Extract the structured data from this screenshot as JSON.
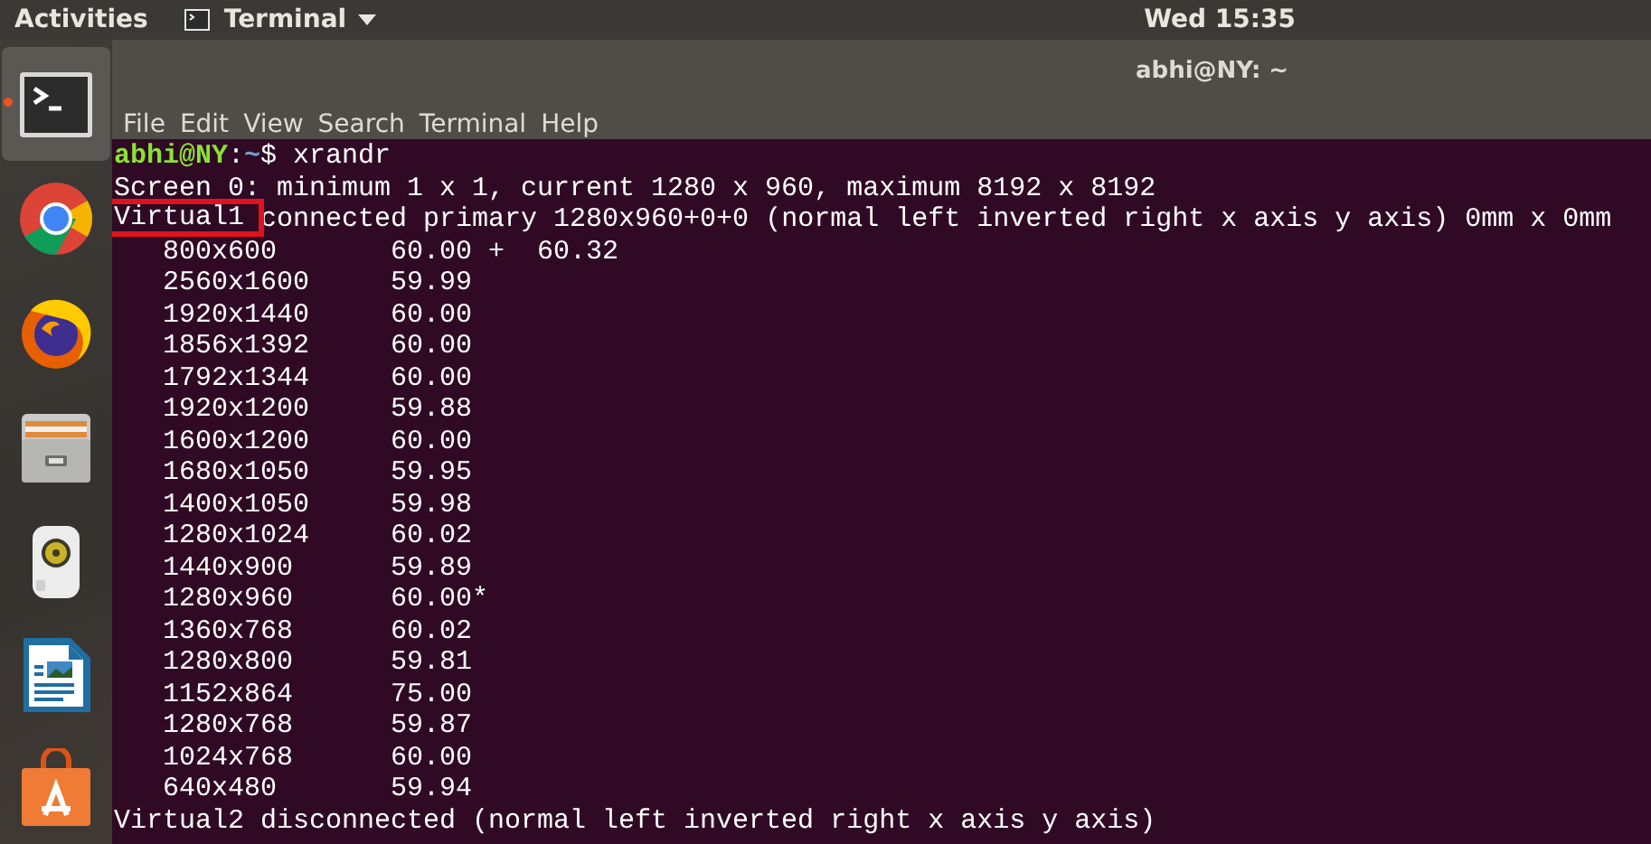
{
  "top_bar": {
    "activities": "Activities",
    "app_menu": "Terminal",
    "clock": "Wed 15:35"
  },
  "dock": {
    "items": [
      {
        "kind": "terminal",
        "selected": true,
        "running": true
      },
      {
        "kind": "chrome",
        "selected": false,
        "running": false
      },
      {
        "kind": "firefox",
        "selected": false,
        "running": false
      },
      {
        "kind": "files",
        "selected": false,
        "running": false
      },
      {
        "kind": "speaker",
        "selected": false,
        "running": false
      },
      {
        "kind": "writer",
        "selected": false,
        "running": false
      },
      {
        "kind": "store",
        "selected": false,
        "running": false
      }
    ]
  },
  "window": {
    "title": "abhi@NY: ~"
  },
  "menu": [
    "File",
    "Edit",
    "View",
    "Search",
    "Terminal",
    "Help"
  ],
  "terminal": {
    "lines": [
      {
        "parts": [
          {
            "kind": "user",
            "text": "abhi@NY"
          },
          {
            "kind": "plain",
            "text": ":"
          },
          {
            "kind": "path",
            "text": "~"
          },
          {
            "kind": "plain",
            "text": "$ xrandr"
          }
        ]
      },
      {
        "parts": [
          {
            "kind": "plain",
            "text": "Screen 0: minimum 1 x 1, current 1280 x 960, maximum 8192 x 8192"
          }
        ]
      },
      {
        "parts": [
          {
            "kind": "boxed",
            "text": "Virtual1"
          },
          {
            "kind": "plain",
            "text": " connected primary 1280x960+0+0 (normal left inverted right x axis y axis) 0mm x 0mm"
          }
        ]
      },
      {
        "parts": [
          {
            "kind": "plain",
            "text": "   800x600       60.00 +  60.32"
          }
        ]
      },
      {
        "parts": [
          {
            "kind": "plain",
            "text": "   2560x1600     59.99"
          }
        ]
      },
      {
        "parts": [
          {
            "kind": "plain",
            "text": "   1920x1440     60.00"
          }
        ]
      },
      {
        "parts": [
          {
            "kind": "plain",
            "text": "   1856x1392     60.00"
          }
        ]
      },
      {
        "parts": [
          {
            "kind": "plain",
            "text": "   1792x1344     60.00"
          }
        ]
      },
      {
        "parts": [
          {
            "kind": "plain",
            "text": "   1920x1200     59.88"
          }
        ]
      },
      {
        "parts": [
          {
            "kind": "plain",
            "text": "   1600x1200     60.00"
          }
        ]
      },
      {
        "parts": [
          {
            "kind": "plain",
            "text": "   1680x1050     59.95"
          }
        ]
      },
      {
        "parts": [
          {
            "kind": "plain",
            "text": "   1400x1050     59.98"
          }
        ]
      },
      {
        "parts": [
          {
            "kind": "plain",
            "text": "   1280x1024     60.02"
          }
        ]
      },
      {
        "parts": [
          {
            "kind": "plain",
            "text": "   1440x900      59.89"
          }
        ]
      },
      {
        "parts": [
          {
            "kind": "plain",
            "text": "   1280x960      60.00*"
          }
        ]
      },
      {
        "parts": [
          {
            "kind": "plain",
            "text": "   1360x768      60.02"
          }
        ]
      },
      {
        "parts": [
          {
            "kind": "plain",
            "text": "   1280x800      59.81"
          }
        ]
      },
      {
        "parts": [
          {
            "kind": "plain",
            "text": "   1152x864      75.00"
          }
        ]
      },
      {
        "parts": [
          {
            "kind": "plain",
            "text": "   1280x768      59.87"
          }
        ]
      },
      {
        "parts": [
          {
            "kind": "plain",
            "text": "   1024x768      60.00"
          }
        ]
      },
      {
        "parts": [
          {
            "kind": "plain",
            "text": "   640x480       59.94"
          }
        ]
      },
      {
        "parts": [
          {
            "kind": "plain",
            "text": "Virtual2 disconnected (normal left inverted right x axis y axis)"
          }
        ]
      }
    ]
  }
}
